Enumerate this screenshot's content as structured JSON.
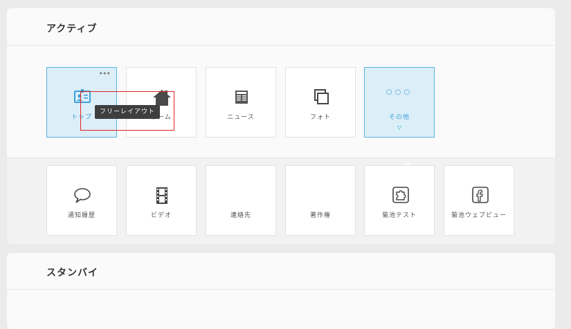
{
  "sections": {
    "active": {
      "title": "アクティブ"
    },
    "standby": {
      "title": "スタンバイ"
    }
  },
  "active_tiles": [
    {
      "label": "トップ",
      "icon": "profile-card-icon",
      "selected": true
    },
    {
      "label": "ホーム",
      "icon": "home-icon"
    },
    {
      "label": "ニュース",
      "icon": "newspaper-icon"
    },
    {
      "label": "フォト",
      "icon": "photo-stack-icon"
    },
    {
      "label": "その他",
      "icon": "more-dots-icon",
      "selected": true
    }
  ],
  "more_tiles": [
    {
      "label": "通知履歴",
      "icon": "speech-bubble-icon"
    },
    {
      "label": "ビデオ",
      "icon": "film-icon"
    },
    {
      "label": "連絡先"
    },
    {
      "label": "著作権"
    },
    {
      "label": "菊池テスト",
      "icon": "puzzle-icon"
    },
    {
      "label": "菊池ウェブビュー",
      "icon": "facebook-icon"
    }
  ],
  "tile_menu": "•••",
  "more_caret": "▽",
  "tooltip": {
    "text": "フリーレイアウト"
  },
  "colors": {
    "accent": "#3aa0d8",
    "selected_bg": "#dceef8",
    "highlight": "#e02020"
  }
}
